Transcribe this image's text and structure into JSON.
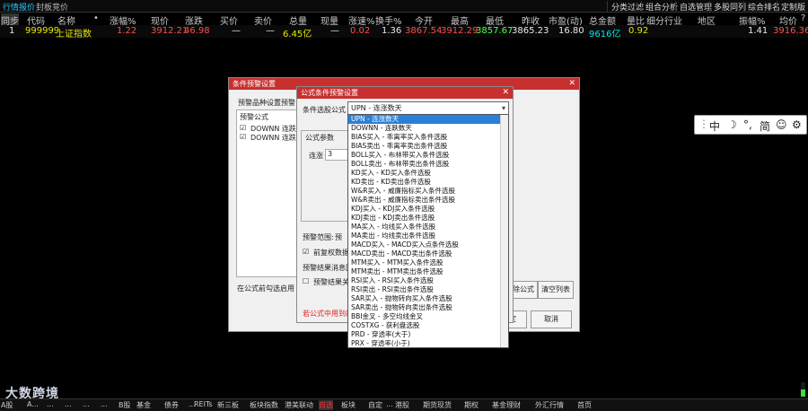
{
  "topbar": {
    "tabs": [
      "行情报价",
      "封板竞价"
    ],
    "right": [
      "分类过滤",
      "组合分析",
      "自选管理",
      "多股同列",
      "综合排名",
      "定制版面"
    ]
  },
  "header": {
    "cols": [
      "同步",
      "代码",
      "名称",
      "•",
      "涨幅%",
      "现价",
      "涨跌",
      "买价",
      "卖价",
      "总量",
      "现量",
      "涨速%",
      "换手%",
      "今开",
      "最高",
      "最低",
      "昨收",
      "市盈(动)",
      "总金额",
      "量比",
      "细分行业",
      "地区",
      "振幅%",
      "均价",
      "?"
    ]
  },
  "row": {
    "idx": "1",
    "code": "999999",
    "name": "上证指数",
    "chg_pct": "1.22",
    "price": "3912.21",
    "change": "46.98",
    "bid": "—",
    "ask": "—",
    "vol": "6.45亿",
    "cur_vol": "—",
    "speed": "0.02",
    "turnover": "1.36",
    "open": "3867.54",
    "high": "3912.29",
    "low": "3857.67",
    "prev": "3865.23",
    "pe": "16.80",
    "amount": "9616亿",
    "vol_ratio": "0.92",
    "amplitude": "1.41",
    "avg": "3916.36"
  },
  "ime": {
    "items": [
      "中",
      "☽",
      "°,",
      "简",
      "☺",
      "⚙"
    ]
  },
  "dialog1": {
    "title": "条件预警设置",
    "tab1": "预警品种设置",
    "tab2": "预警",
    "list_title": "预警公式",
    "list_items": [
      "DOWNN 连跌",
      "DOWNN 连跌"
    ],
    "bottom_label": "在公式前勾选启用",
    "btn_ok": "确定",
    "btn_cancel": "取消",
    "btn_del": "删除公式",
    "btn_clear": "清空列表"
  },
  "dialog2": {
    "title": "公式条件预警设置",
    "formula_label": "条件选股公式",
    "selected": "UPN  -  连涨数天",
    "param_group": "公式参数",
    "param_label": "连涨",
    "param_value": "3",
    "range_label": "预警范围:",
    "range_opt": "预",
    "check1": "前复权数据",
    "result_label": "预警结果消息回放",
    "check2": "预警结果关联",
    "note": "若公式中用到的"
  },
  "dropdown": {
    "items": [
      "UPN  -  连涨数天",
      "DOWNN  -  连跌数天",
      "BIAS买入  -  乖离率买入条件选股",
      "BIAS卖出  -  乖离率卖出条件选股",
      "BOLL买入  -  布林带买入条件选股",
      "BOLL卖出  -  布林带卖出条件选股",
      "KD买入  -  KD买入条件选股",
      "KD卖出  -  KD卖出条件选股",
      "W&R买入  -  威廉指标买入条件选股",
      "W&R卖出  -  威廉指标卖出条件选股",
      "KDJ买入  -  KDJ买入条件选股",
      "KDJ卖出  -  KDJ卖出条件选股",
      "MA买入  -  均线买入条件选股",
      "MA卖出  -  均线卖出条件选股",
      "MACD买入  -  MACD买入点条件选股",
      "MACD卖出  -  MACD卖出条件选股",
      "MTM买入  -  MTM买入条件选股",
      "MTM卖出  -  MTM卖出条件选股",
      "RSI买入  -  RSI买入条件选股",
      "RSI卖出  -  RSI卖出条件选股",
      "SAR买入  -  抛物转向买入条件选股",
      "SAR卖出  -  抛物转向卖出条件选股",
      "BBI金叉  -  多空均线金叉",
      "COSTXG  -  获利盘选股",
      "PRD  -  穿透率(大于)",
      "PRX  -  穿透率(小于)"
    ]
  },
  "bottom": {
    "tabs": [
      "A股",
      "A...",
      "...",
      "...",
      "...",
      "...",
      "B股",
      "基金",
      "债券",
      "...",
      "REITs",
      "新三板",
      "板块指数",
      "港美联动",
      "自选",
      "板块",
      "自定",
      "...",
      "港股",
      "期货现货",
      "期权",
      "基金理财",
      "外汇行情",
      "首页"
    ]
  },
  "watermark": "大数跨境"
}
